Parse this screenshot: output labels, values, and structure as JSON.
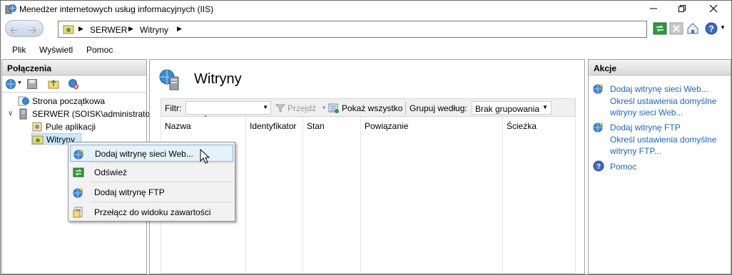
{
  "window": {
    "title": "Menedżer internetowych usług informacyjnych (IIS)"
  },
  "address": {
    "crumbs": [
      "SERWER",
      "Witryny"
    ]
  },
  "menu": {
    "items": [
      "Plik",
      "Wyświetl",
      "Pomoc"
    ]
  },
  "connections": {
    "header": "Połączenia",
    "tree": {
      "start_page": "Strona początkowa",
      "server": "SERWER (SOISK\\administrator",
      "app_pools": "Pule aplikacji",
      "sites": "Witryny"
    }
  },
  "center": {
    "title": "Witryny",
    "filter": {
      "label": "Filtr:",
      "go": "Przejdź",
      "show_all": "Pokaż wszystko",
      "group_by_label": "Grupuj według:",
      "group_by_value": "Brak grupowania"
    },
    "columns": [
      "Nazwa",
      "Identyfikator",
      "Stan",
      "Powiązanie",
      "Ścieżka"
    ]
  },
  "actions": {
    "header": "Akcje",
    "add_web_site": "Dodaj witrynę sieci Web...",
    "web_defaults_line1": "Określ ustawienia domyślne",
    "web_defaults_line2": "witryny sieci Web...",
    "add_ftp_site": "Dodaj witrynę FTP",
    "ftp_defaults_line1": "Określ ustawienia domyślne",
    "ftp_defaults_line2": "witryny FTP...",
    "help": "Pomoc"
  },
  "context_menu": {
    "items": [
      "Dodaj witrynę sieci Web...",
      "Odśwież",
      "Dodaj witrynę FTP",
      "Przełącz do widoku zawartości"
    ]
  },
  "colors": {
    "link": "#1a64c8",
    "highlight": "#e5f1fb",
    "highlight_border": "#7fb2e6"
  }
}
